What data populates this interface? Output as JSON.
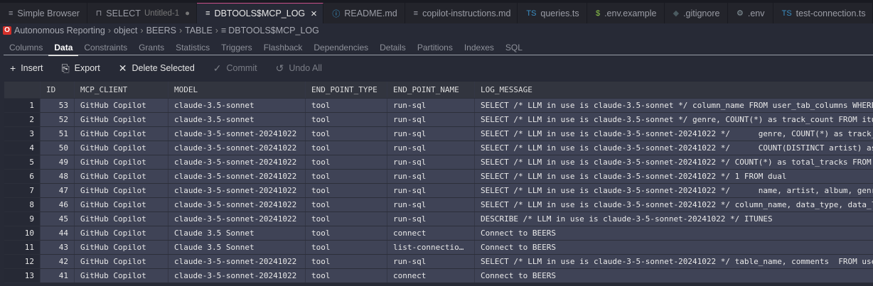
{
  "tabs": [
    {
      "icon": "file-lines-icon",
      "glyph": "≡",
      "label": "Simple Browser"
    },
    {
      "icon": "database-icon",
      "glyph": "⊓",
      "label": "SELECT",
      "sub": "Untitled-1",
      "dirty": "●"
    },
    {
      "icon": "file-lines-icon",
      "glyph": "≡",
      "label": "DBTOOLS$MCP_LOG",
      "close": "×",
      "active": true
    },
    {
      "icon": "info-icon",
      "glyph": "ⓘ",
      "label": "README.md",
      "color": "#3b9fd8"
    },
    {
      "icon": "file-lines-icon",
      "glyph": "≡",
      "label": "copilot-instructions.md"
    },
    {
      "icon": "typescript-icon",
      "glyph": "TS",
      "label": "queries.ts",
      "color": "#3b8fc4"
    },
    {
      "icon": "dollar-icon",
      "glyph": "$",
      "label": ".env.example",
      "color": "#8bc34a"
    },
    {
      "icon": "git-icon",
      "glyph": "◆",
      "label": ".gitignore",
      "color": "#4a5a60"
    },
    {
      "icon": "gear-icon",
      "glyph": "⚙",
      "label": ".env",
      "color": "#8a9aa0"
    },
    {
      "icon": "typescript-icon",
      "glyph": "TS",
      "label": "test-connection.ts",
      "color": "#3b8fc4"
    }
  ],
  "breadcrumb": [
    "Autonomous Reporting",
    "object",
    "BEERS",
    "TABLE",
    "DBTOOLS$MCP_LOG"
  ],
  "subtabs": [
    "Columns",
    "Data",
    "Constraints",
    "Grants",
    "Statistics",
    "Triggers",
    "Flashback",
    "Dependencies",
    "Details",
    "Partitions",
    "Indexes",
    "SQL"
  ],
  "active_subtab": "Data",
  "toolbar": [
    {
      "icon": "plus-icon",
      "glyph": "+",
      "label": "Insert",
      "enabled": true
    },
    {
      "icon": "export-icon",
      "glyph": "⎘",
      "label": "Export",
      "enabled": true
    },
    {
      "icon": "close-icon",
      "glyph": "✕",
      "label": "Delete Selected",
      "enabled": true
    },
    {
      "icon": "check-icon",
      "glyph": "✓",
      "label": "Commit",
      "enabled": false
    },
    {
      "icon": "undo-icon",
      "glyph": "↺",
      "label": "Undo All",
      "enabled": false
    }
  ],
  "table": {
    "columns": [
      "",
      "ID",
      "MCP_CLIENT",
      "MODEL",
      "END_POINT_TYPE",
      "END_POINT_NAME",
      "LOG_MESSAGE"
    ],
    "rows": [
      [
        "1",
        "53",
        "GitHub Copilot",
        "claude-3.5-sonnet",
        "tool",
        "run-sql",
        "SELECT /* LLM in use is claude-3.5-sonnet */ column_name FROM user_tab_columns WHERE"
      ],
      [
        "2",
        "52",
        "GitHub Copilot",
        "claude-3.5-sonnet",
        "tool",
        "run-sql",
        "SELECT /* LLM in use is claude-3.5-sonnet */ genre, COUNT(*) as track_count FROM itun"
      ],
      [
        "3",
        "51",
        "GitHub Copilot",
        "claude-3-5-sonnet-20241022",
        "tool",
        "run-sql",
        "SELECT /* LLM in use is claude-3-5-sonnet-20241022 */      genre, COUNT(*) as track_c"
      ],
      [
        "4",
        "50",
        "GitHub Copilot",
        "claude-3-5-sonnet-20241022",
        "tool",
        "run-sql",
        "SELECT /* LLM in use is claude-3-5-sonnet-20241022 */      COUNT(DISTINCT artist) as"
      ],
      [
        "5",
        "49",
        "GitHub Copilot",
        "claude-3-5-sonnet-20241022",
        "tool",
        "run-sql",
        "SELECT /* LLM in use is claude-3-5-sonnet-20241022 */ COUNT(*) as total_tracks FROM i"
      ],
      [
        "6",
        "48",
        "GitHub Copilot",
        "claude-3-5-sonnet-20241022",
        "tool",
        "run-sql",
        "SELECT /* LLM in use is claude-3-5-sonnet-20241022 */ 1 FROM dual"
      ],
      [
        "7",
        "47",
        "GitHub Copilot",
        "claude-3-5-sonnet-20241022",
        "tool",
        "run-sql",
        "SELECT /* LLM in use is claude-3-5-sonnet-20241022 */      name, artist, album, genre"
      ],
      [
        "8",
        "46",
        "GitHub Copilot",
        "claude-3-5-sonnet-20241022",
        "tool",
        "run-sql",
        "SELECT /* LLM in use is claude-3-5-sonnet-20241022 */ column_name, data_type, data_le"
      ],
      [
        "9",
        "45",
        "GitHub Copilot",
        "claude-3-5-sonnet-20241022",
        "tool",
        "run-sql",
        "DESCRIBE /* LLM in use is claude-3-5-sonnet-20241022 */ ITUNES"
      ],
      [
        "10",
        "44",
        "GitHub Copilot",
        "Claude 3.5 Sonnet",
        "tool",
        "connect",
        "Connect to BEERS"
      ],
      [
        "11",
        "43",
        "GitHub Copilot",
        "Claude 3.5 Sonnet",
        "tool",
        "list-connectio…",
        "Connect to BEERS"
      ],
      [
        "12",
        "42",
        "GitHub Copilot",
        "claude-3-5-sonnet-20241022",
        "tool",
        "run-sql",
        "SELECT /* LLM in use is claude-3-5-sonnet-20241022 */ table_name, comments  FROM user"
      ],
      [
        "13",
        "41",
        "GitHub Copilot",
        "claude-3-5-sonnet-20241022",
        "tool",
        "connect",
        "Connect to BEERS"
      ]
    ]
  }
}
